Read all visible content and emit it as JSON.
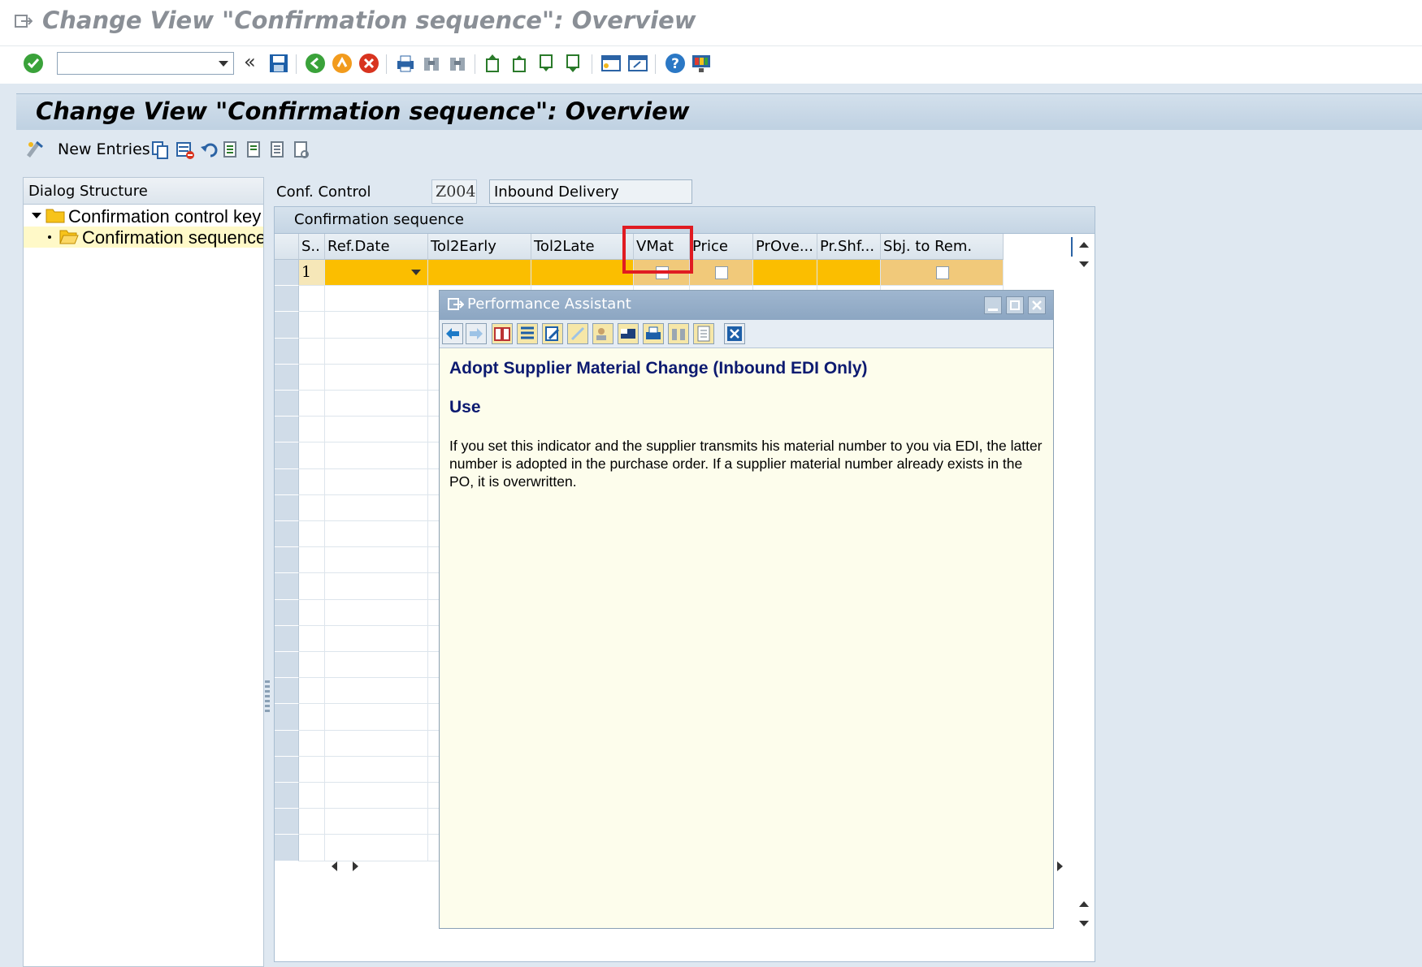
{
  "window": {
    "title": "Change View \"Confirmation sequence\": Overview"
  },
  "page": {
    "title": "Change View \"Confirmation sequence\": Overview",
    "new_entries_label": "New Entries"
  },
  "dialog_structure": {
    "header": "Dialog Structure",
    "items": [
      {
        "label": "Confirmation control key"
      },
      {
        "label": "Confirmation sequence"
      }
    ]
  },
  "conf_control": {
    "label": "Conf. Control",
    "value": "Z004",
    "description": "Inbound Delivery"
  },
  "table": {
    "title": "Confirmation sequence",
    "columns": [
      "S..",
      "Ref.Date",
      "Tol2Early",
      "Tol2Late",
      "VMat",
      "Price",
      "PrOve...",
      "Pr.Shf...",
      "Sbj. to Rem."
    ],
    "row1": {
      "seq": "1"
    }
  },
  "performance_assistant": {
    "title": "Performance Assistant",
    "heading": "Adopt Supplier Material Change (Inbound EDI Only)",
    "subheading": "Use",
    "body": "If you set this indicator and the supplier transmits his material number to you via EDI, the latter number is adopted in the purchase order. If a supplier material number already exists in the PO, it is overwritten."
  },
  "colors": {
    "accent_row": "#fbbe00",
    "highlight": "#e01b22",
    "heading_text": "#0c1a70"
  }
}
